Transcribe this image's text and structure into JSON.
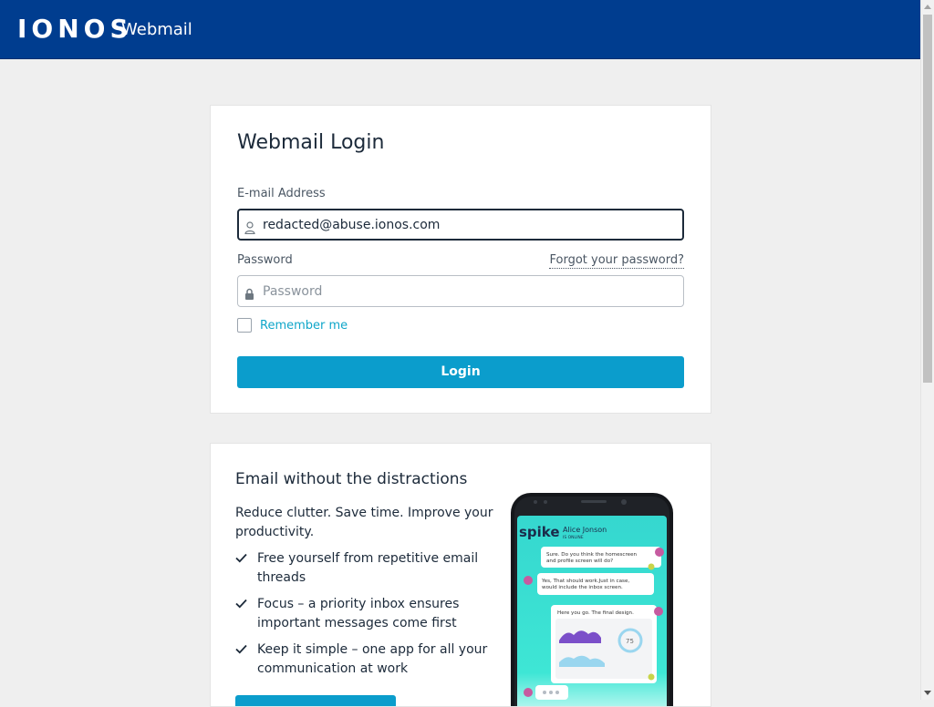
{
  "header": {
    "brand": "IONOS",
    "app_name": "Webmail"
  },
  "login": {
    "title": "Webmail Login",
    "email_label": "E-mail Address",
    "email_value": "redacted@abuse.ionos.com",
    "password_label": "Password",
    "password_placeholder": "Password",
    "forgot_label": "Forgot your password?",
    "remember_label": "Remember me",
    "login_button": "Login"
  },
  "promo": {
    "title": "Email without the distractions",
    "text": "Reduce clutter. Save time. Improve your productivity.",
    "benefits": [
      "Free yourself from repetitive email threads",
      "Focus – a priority inbox ensures important messages come first",
      "Keep it simple – one app for all your communication at work"
    ],
    "phone": {
      "app_logo": "spike",
      "contact_name": "Alice Jonson",
      "contact_status": "IS ONLINE",
      "messages": [
        "Sure. Do you think the homescreen and profile screen will do?",
        "Yes, That should work.Just in case, would include the inbox screen.",
        "Here you go. The final design."
      ],
      "chart_number": "75"
    }
  },
  "colors": {
    "header_bg": "#003d8f",
    "page_bg": "#efefef",
    "accent": "#0b9dcc",
    "link_teal": "#0fa6c9"
  },
  "icons": [
    "user-icon",
    "lock-icon",
    "check-icon"
  ]
}
